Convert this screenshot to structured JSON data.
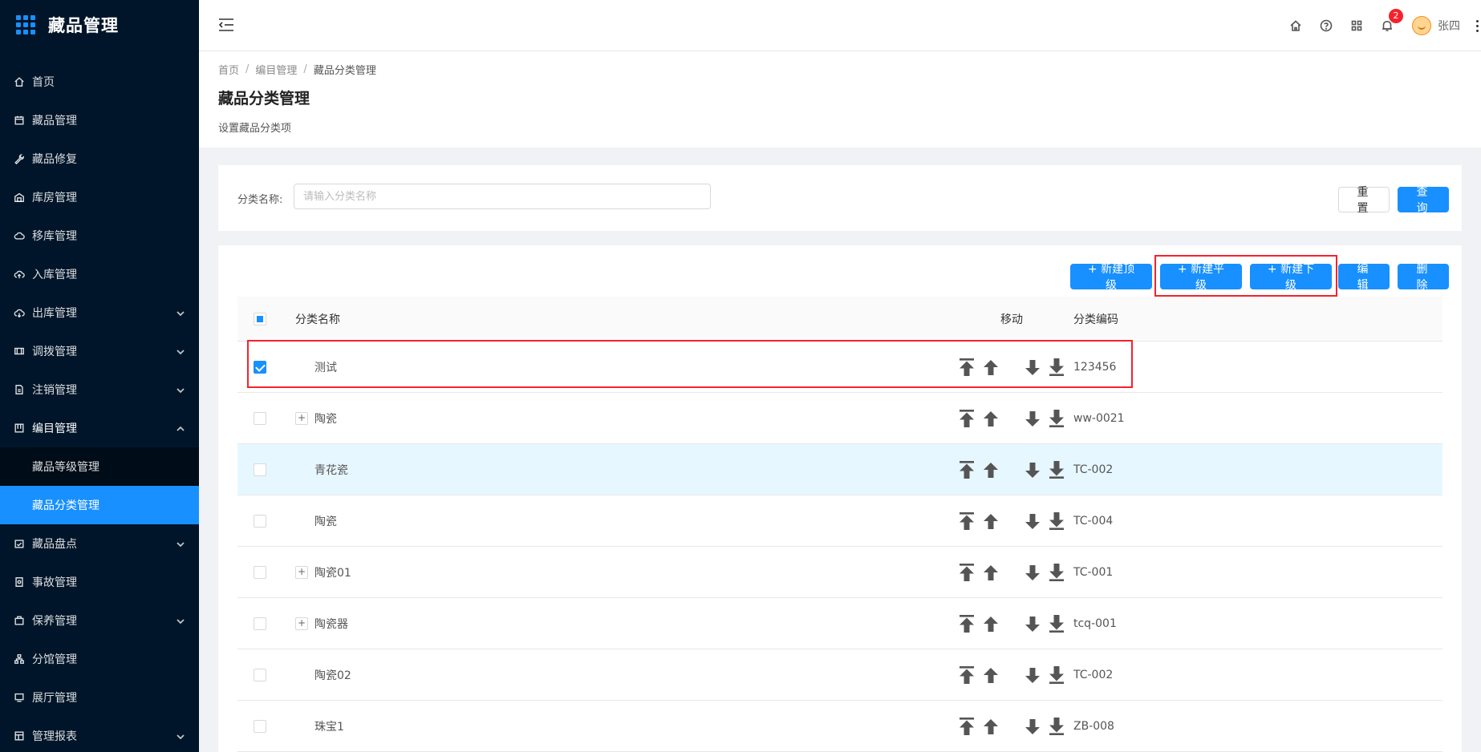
{
  "app": {
    "title": "藏品管理"
  },
  "sidebar": {
    "items": [
      {
        "label": "首页",
        "icon": "home-icon",
        "has_children": false
      },
      {
        "label": "藏品管理",
        "icon": "calendar-icon",
        "has_children": false
      },
      {
        "label": "藏品修复",
        "icon": "wrench-icon",
        "has_children": false
      },
      {
        "label": "库房管理",
        "icon": "warehouse-icon",
        "has_children": false
      },
      {
        "label": "移库管理",
        "icon": "cloud-icon",
        "has_children": false
      },
      {
        "label": "入库管理",
        "icon": "cloud-upload-icon",
        "has_children": false
      },
      {
        "label": "出库管理",
        "icon": "cloud-download-icon",
        "has_children": true
      },
      {
        "label": "调拨管理",
        "icon": "transfer-icon",
        "has_children": true
      },
      {
        "label": "注销管理",
        "icon": "file-icon",
        "has_children": true
      },
      {
        "label": "编目管理",
        "icon": "catalog-icon",
        "has_children": true,
        "open": true,
        "children": [
          {
            "label": "藏品等级管理"
          },
          {
            "label": "藏品分类管理",
            "active": true
          }
        ]
      },
      {
        "label": "藏品盘点",
        "icon": "inventory-icon",
        "has_children": true
      },
      {
        "label": "事故管理",
        "icon": "report-icon",
        "has_children": false
      },
      {
        "label": "保养管理",
        "icon": "maintenance-icon",
        "has_children": true
      },
      {
        "label": "分馆管理",
        "icon": "org-icon",
        "has_children": false
      },
      {
        "label": "展厅管理",
        "icon": "monitor-icon",
        "has_children": false
      },
      {
        "label": "管理报表",
        "icon": "table-icon",
        "has_children": true
      }
    ]
  },
  "header": {
    "notification_count": "2",
    "user_name": "张四"
  },
  "breadcrumb": [
    "首页",
    "编目管理",
    "藏品分类管理"
  ],
  "page": {
    "title": "藏品分类管理",
    "description": "设置藏品分类项"
  },
  "search": {
    "label": "分类名称:",
    "placeholder": "请输入分类名称",
    "value": "",
    "reset_label": "重置",
    "query_label": "查询"
  },
  "toolbar": {
    "new_top_label": "+ 新建顶级",
    "new_sibling_label": "+ 新建平级",
    "new_child_label": "+ 新建下级",
    "edit_label": "编辑",
    "delete_label": "删除"
  },
  "table": {
    "columns": [
      "分类名称",
      "移动",
      "分类编码"
    ],
    "rows": [
      {
        "name": "测试",
        "code": "123456",
        "checked": true,
        "expandable": false
      },
      {
        "name": "陶瓷",
        "code": "ww-0021",
        "checked": false,
        "expandable": true
      },
      {
        "name": "青花瓷",
        "code": "TC-002",
        "checked": false,
        "expandable": false,
        "hover": true
      },
      {
        "name": "陶瓷",
        "code": "TC-004",
        "checked": false,
        "expandable": false
      },
      {
        "name": "陶瓷01",
        "code": "TC-001",
        "checked": false,
        "expandable": true
      },
      {
        "name": "陶瓷器",
        "code": "tcq-001",
        "checked": false,
        "expandable": true
      },
      {
        "name": "陶瓷02",
        "code": "TC-002",
        "checked": false,
        "expandable": false
      },
      {
        "name": "珠宝1",
        "code": "ZB-008",
        "checked": false,
        "expandable": false
      }
    ]
  },
  "colors": {
    "primary": "#1890ff",
    "sidebar_bg": "#001529",
    "highlight_red": "#f5222d",
    "row_hover": "#e6f7ff"
  }
}
